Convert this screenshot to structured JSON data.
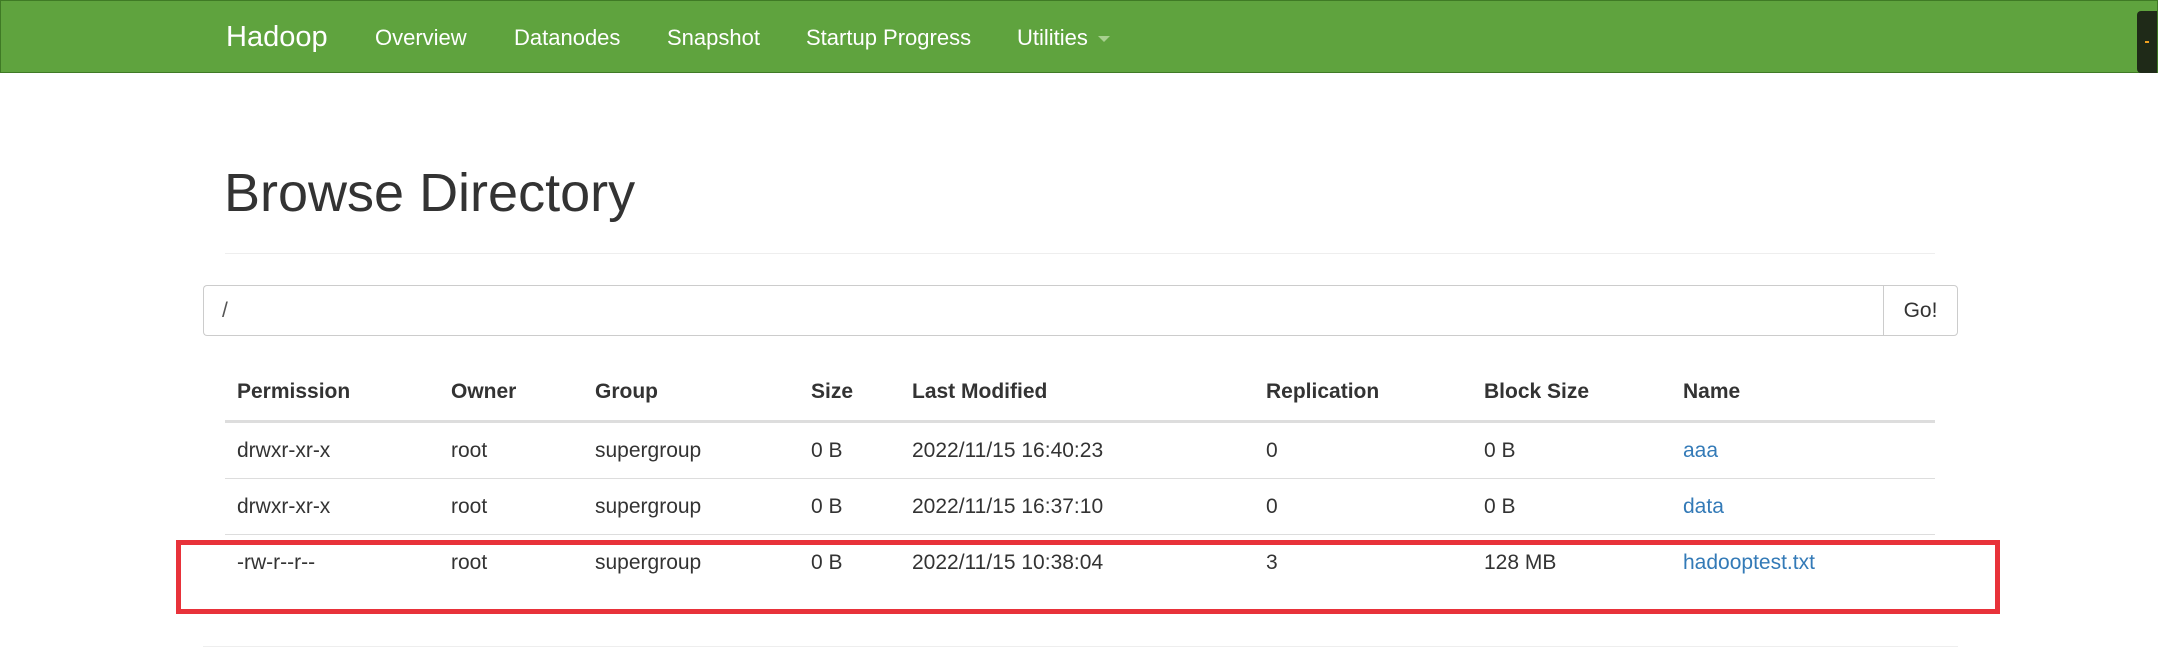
{
  "navbar": {
    "brand": "Hadoop",
    "items": [
      {
        "label": "Overview"
      },
      {
        "label": "Datanodes"
      },
      {
        "label": "Snapshot"
      },
      {
        "label": "Startup Progress"
      },
      {
        "label": "Utilities"
      }
    ],
    "color": "#5fa33e"
  },
  "page": {
    "title": "Browse Directory"
  },
  "search": {
    "path_value": "/",
    "go_label": "Go!"
  },
  "table": {
    "columns": [
      "Permission",
      "Owner",
      "Group",
      "Size",
      "Last Modified",
      "Replication",
      "Block Size",
      "Name"
    ],
    "rows": [
      {
        "permission": "drwxr-xr-x",
        "owner": "root",
        "group": "supergroup",
        "size": "0 B",
        "modified": "2022/11/15 16:40:23",
        "replication": "0",
        "block_size": "0 B",
        "name": "aaa"
      },
      {
        "permission": "drwxr-xr-x",
        "owner": "root",
        "group": "supergroup",
        "size": "0 B",
        "modified": "2022/11/15 16:37:10",
        "replication": "0",
        "block_size": "0 B",
        "name": "data"
      },
      {
        "permission": "-rw-r--r--",
        "owner": "root",
        "group": "supergroup",
        "size": "0 B",
        "modified": "2022/11/15 10:38:04",
        "replication": "3",
        "block_size": "128 MB",
        "name": "hadooptest.txt"
      }
    ]
  },
  "colors": {
    "link": "#337ab7",
    "highlight": "#e8323a"
  }
}
